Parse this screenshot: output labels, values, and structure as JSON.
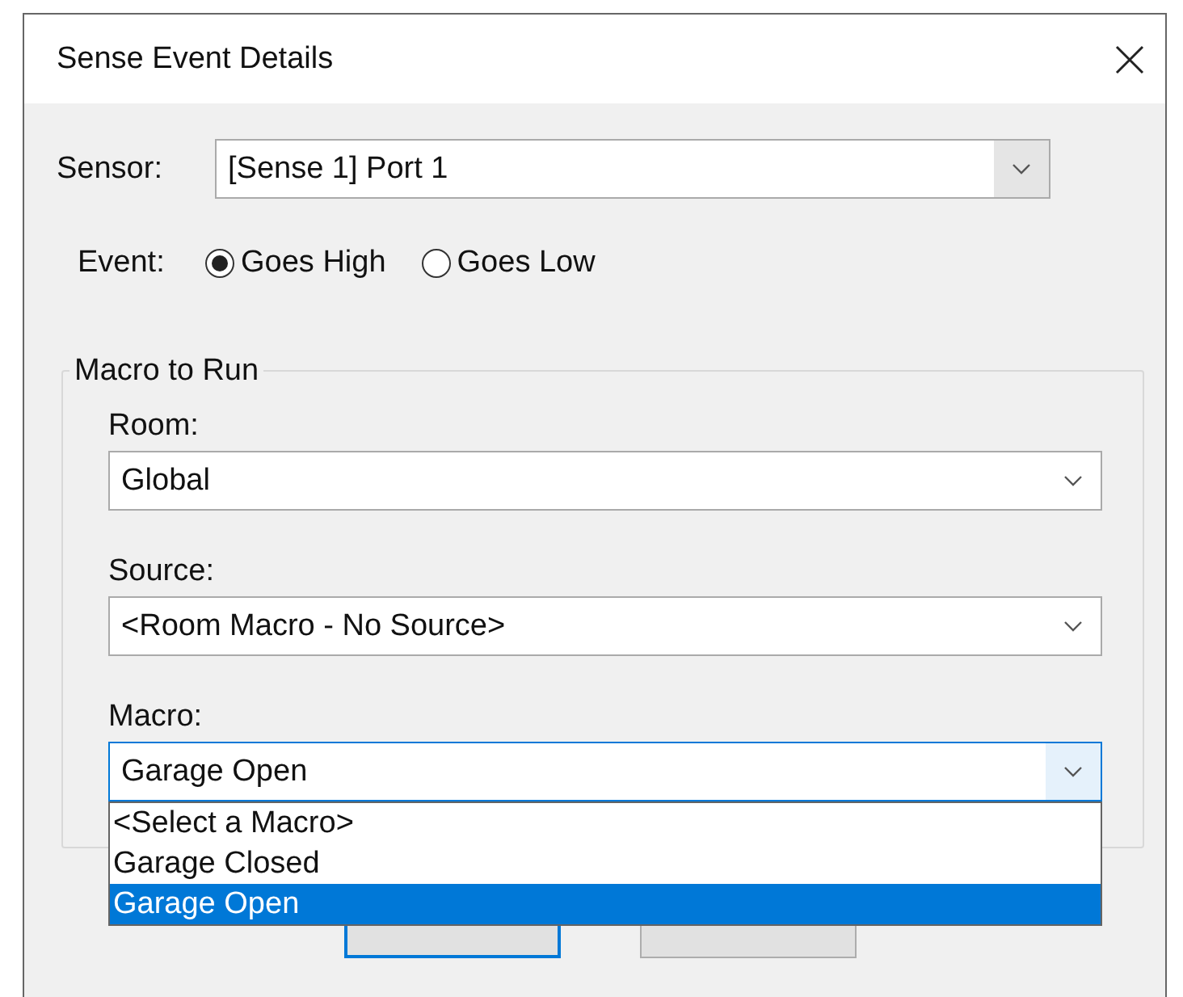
{
  "window": {
    "title": "Sense Event Details"
  },
  "sensor": {
    "label": "Sensor:",
    "value": "[Sense 1] Port 1"
  },
  "event": {
    "label": "Event:",
    "options": [
      {
        "label": "Goes High",
        "selected": true
      },
      {
        "label": "Goes Low",
        "selected": false
      }
    ]
  },
  "macro_group": {
    "title": "Macro to Run",
    "fields": [
      {
        "label": "Room:",
        "value": "Global",
        "focused": false
      },
      {
        "label": "Source:",
        "value": "<Room Macro - No Source>",
        "focused": false
      },
      {
        "label": "Macro:",
        "value": "Garage Open",
        "focused": true,
        "expanded": true,
        "options": [
          {
            "label": "<Select a Macro>",
            "selected": false
          },
          {
            "label": "Garage Closed",
            "selected": false
          },
          {
            "label": "Garage Open",
            "selected": true
          }
        ]
      }
    ]
  },
  "buttons": [
    {
      "default": true
    },
    {
      "default": false
    }
  ]
}
